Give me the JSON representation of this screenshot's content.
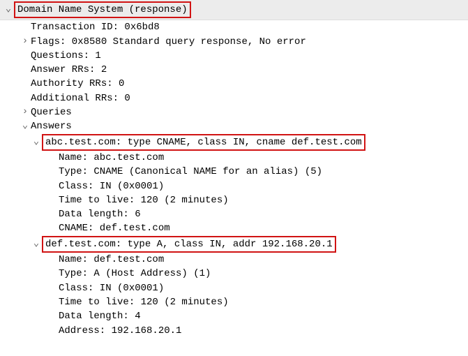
{
  "header_title": "Domain Name System (response)",
  "fields": {
    "transaction_id": "Transaction ID: 0x6bd8",
    "flags": "Flags: 0x8580 Standard query response, No error",
    "questions": "Questions: 1",
    "answer_rrs": "Answer RRs: 2",
    "authority_rrs": "Authority RRs: 0",
    "additional_rrs": "Additional RRs: 0",
    "queries": "Queries",
    "answers": "Answers"
  },
  "answer1": {
    "summary": "abc.test.com: type CNAME, class IN, cname def.test.com",
    "name": "Name: abc.test.com",
    "type": "Type: CNAME (Canonical NAME for an alias) (5)",
    "class": "Class: IN (0x0001)",
    "ttl": "Time to live: 120 (2 minutes)",
    "datalen": "Data length: 6",
    "cname": "CNAME: def.test.com"
  },
  "answer2": {
    "summary": "def.test.com: type A, class IN, addr 192.168.20.1",
    "name": "Name: def.test.com",
    "type": "Type: A (Host Address) (1)",
    "class": "Class: IN (0x0001)",
    "ttl": "Time to live: 120 (2 minutes)",
    "datalen": "Data length: 4",
    "address": "Address: 192.168.20.1"
  }
}
